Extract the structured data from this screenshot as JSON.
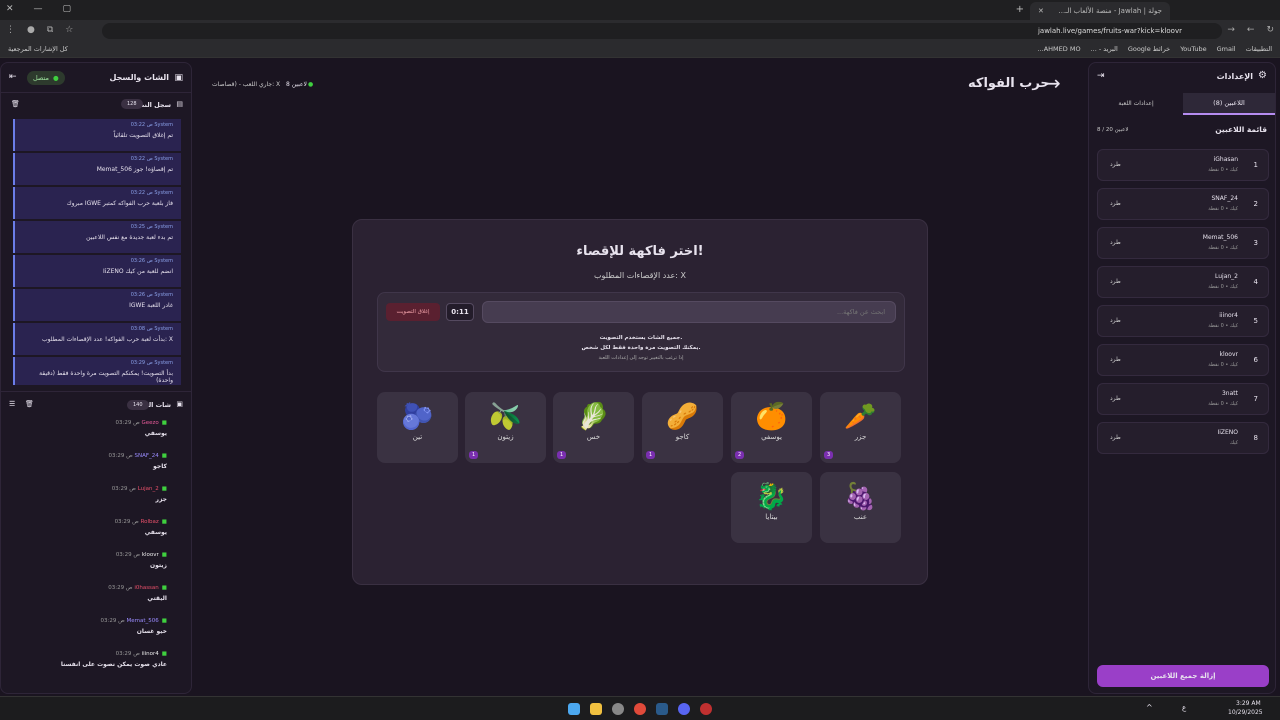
{
  "browser": {
    "tab_title": "جولة | Jawlah - منصة الألعاب الـ...",
    "url": "jawlah.live/games/fruits-war?kick=kloovr",
    "bookmarks": [
      "التطبيقات",
      "Gmail",
      "YouTube",
      "خرائط Google",
      "البريد - ...",
      "AHMED MO..."
    ],
    "bookmarks_left": "كل الإشارات المرجعية"
  },
  "header": {
    "title": "حرب الفواكه",
    "status": "جاري اللعب - (قصاصات: X",
    "players": "8 لاعبين"
  },
  "chat_panel": {
    "title": "الشات والسجل",
    "connected": "متصل",
    "log_title": "سجل النظام",
    "log_count": "128",
    "log": [
      {
        "who": "System",
        "time": "03:22 ص",
        "text": "تم إغلاق التصويت تلقائياً"
      },
      {
        "who": "System",
        "time": "03:22 ص",
        "text": "Memat_506 تم إقصاؤه! جوز"
      },
      {
        "who": "System",
        "time": "03:22 ص",
        "text": "مبروك IGWE فاز بلعبة حرب الفواكه كمتبر"
      },
      {
        "who": "System",
        "time": "03:25 ص",
        "text": "تم بدء لعبة جديدة مع نفس اللاعبين"
      },
      {
        "who": "System",
        "time": "03:26 ص",
        "text": "IiZENO انضم للعبة من كيك"
      },
      {
        "who": "System",
        "time": "03:26 ص",
        "text": "IGWE غادر اللعبة"
      },
      {
        "who": "System",
        "time": "03:08 ص",
        "text": "بدأت لعبة حرب الفواكه! عدد الإقصاءات المطلوب: X"
      },
      {
        "who": "System",
        "time": "03:29 ص",
        "text": "بدأ التصويت! يمكنكم التصويت مرة واحدة فقط (دقيقة واحدة)"
      }
    ],
    "chat_title": "شات البث",
    "chat_count": "140",
    "chat": [
      {
        "name": "Geezo",
        "time": "03:29 ص",
        "text": "يوسفي",
        "color": "#e85a9a"
      },
      {
        "name": "SNAF_24",
        "time": "03:29 ص",
        "text": "كاجو",
        "color": "#9a8cff"
      },
      {
        "name": "Lujan_2",
        "time": "03:29 ص",
        "text": "جزر",
        "color": "#e8506a"
      },
      {
        "name": "Rolbaz",
        "time": "03:29 ص",
        "text": "يوسفي",
        "color": "#e8506a"
      },
      {
        "name": "kloovr",
        "time": "03:29 ص",
        "text": "زيتون",
        "color": "#eee"
      },
      {
        "name": "i0hassan",
        "time": "03:29 ص",
        "text": "اليقتي",
        "color": "#e8506a"
      },
      {
        "name": "Memat_506",
        "time": "03:29 ص",
        "text": "خيو غسان",
        "color": "#9a8cff"
      },
      {
        "name": "iiinor4",
        "time": "03:29 ص",
        "text": "عادي صوت يمكن نصوت على انفسنا",
        "color": "#eee"
      }
    ]
  },
  "game": {
    "heading": "اختر فاكهة للإقصاء!",
    "subtitle": "عدد الإقصاءات المطلوب: X",
    "search_placeholder": "ابحث عن فاكهة...",
    "timer": "0:11",
    "close_vote": "إغلاق التصويت",
    "note1": "جميع الشات يستخدم التصويت.",
    "note2": "يمكنك التصويت مرة واحدة فقط لكل شخص.",
    "note3": "إذا ترغب بالتغيير توجه إلى إعدادات اللعبة",
    "fruits": [
      {
        "label": "جزر",
        "emoji": "🥕",
        "votes": "3"
      },
      {
        "label": "يوسفي",
        "emoji": "🍊",
        "votes": "2"
      },
      {
        "label": "كاجو",
        "emoji": "🥜",
        "votes": "1"
      },
      {
        "label": "خس",
        "emoji": "🥬",
        "votes": "1"
      },
      {
        "label": "زيتون",
        "emoji": "🫒",
        "votes": "1"
      },
      {
        "label": "تين",
        "emoji": "🫐",
        "votes": ""
      },
      {
        "label": "عنب",
        "emoji": "🍇",
        "votes": ""
      },
      {
        "label": "بيتايا",
        "emoji": "🐉",
        "votes": ""
      }
    ]
  },
  "settings": {
    "title": "الإعدادات",
    "tab_players": "اللاعبين (8)",
    "tab_game": "إعدادات اللعبة",
    "list_title": "قائمة اللاعبين",
    "count": "8 / 20 لاعبين",
    "kick": "طرد",
    "remove_all": "إزالة جميع اللاعبين",
    "players": [
      {
        "n": "1",
        "name": "iGhasan",
        "meta": "كيك • 0 نقطة"
      },
      {
        "n": "2",
        "name": "SNAF_24",
        "meta": "كيك • 0 نقطة"
      },
      {
        "n": "3",
        "name": "Memat_506",
        "meta": "كيك • 0 نقطة"
      },
      {
        "n": "4",
        "name": "Lujan_2",
        "meta": "كيك • 0 نقطة"
      },
      {
        "n": "5",
        "name": "iiinor4",
        "meta": "كيك • 0 نقطة"
      },
      {
        "n": "6",
        "name": "kloovr",
        "meta": "كيك • 0 نقطة"
      },
      {
        "n": "7",
        "name": "3natt",
        "meta": "كيك • 0 نقطة"
      },
      {
        "n": "8",
        "name": "IiZENO",
        "meta": "كيك"
      }
    ]
  },
  "taskbar": {
    "time": "3:29 AM",
    "date": "10/29/2025",
    "lang": "ع"
  }
}
